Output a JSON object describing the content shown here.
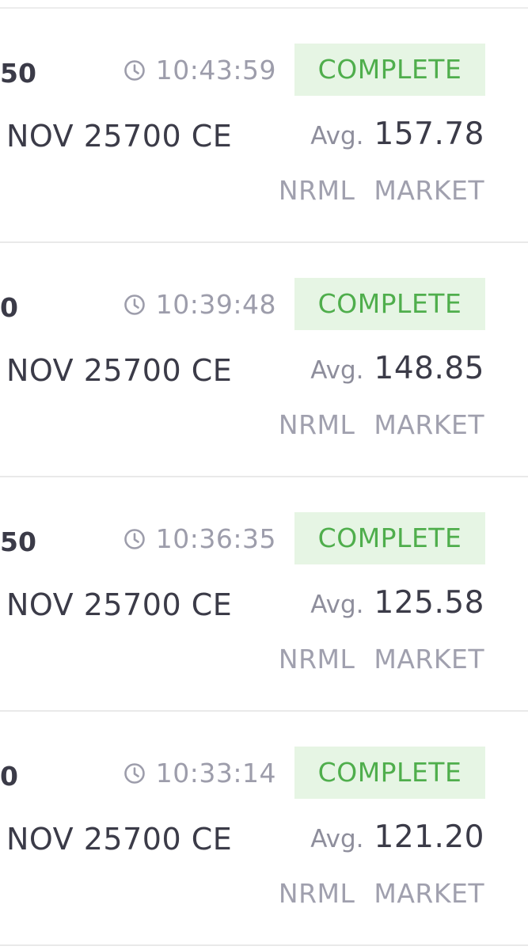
{
  "orders": [
    {
      "qty_fragment": "50",
      "time": "10:43:59",
      "status": "COMPLETE",
      "instrument": "NOV 25700 CE",
      "avg_label": "Avg.",
      "avg_price": "157.78",
      "product": "NRML",
      "order_type": "MARKET"
    },
    {
      "qty_fragment": "0",
      "time": "10:39:48",
      "status": "COMPLETE",
      "instrument": "NOV 25700 CE",
      "avg_label": "Avg.",
      "avg_price": "148.85",
      "product": "NRML",
      "order_type": "MARKET"
    },
    {
      "qty_fragment": "50",
      "time": "10:36:35",
      "status": "COMPLETE",
      "instrument": "NOV 25700 CE",
      "avg_label": "Avg.",
      "avg_price": "125.58",
      "product": "NRML",
      "order_type": "MARKET"
    },
    {
      "qty_fragment": "0",
      "time": "10:33:14",
      "status": "COMPLETE",
      "instrument": "NOV 25700 CE",
      "avg_label": "Avg.",
      "avg_price": "121.20",
      "product": "NRML",
      "order_type": "MARKET"
    }
  ],
  "icons": {
    "time_icon": "clock-icon"
  },
  "colors": {
    "status_text": "#4fae4c",
    "status_bg": "#e6f5e4",
    "primary_text": "#3b3b48",
    "muted_text": "#9d9dab"
  }
}
